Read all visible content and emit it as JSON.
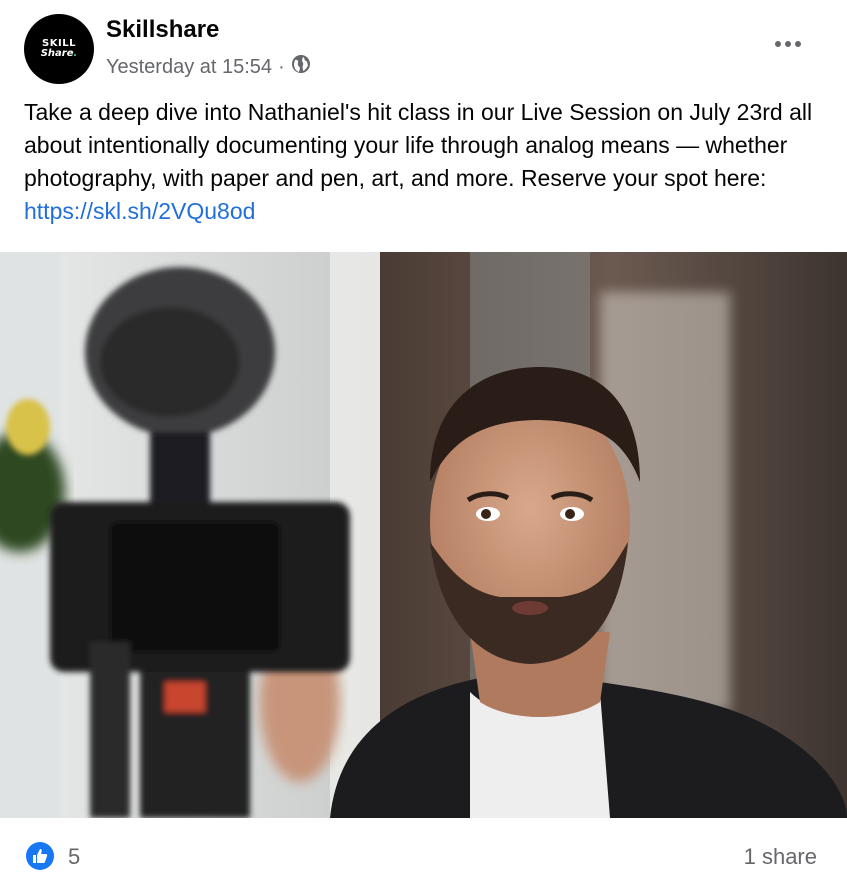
{
  "post": {
    "page_name": "Skillshare",
    "avatar_text": {
      "line1": "SKILL",
      "line2": "Share",
      "dot": "."
    },
    "timestamp": "Yesterday at 15:54",
    "separator": "·",
    "audience_icon": "globe-icon",
    "more_icon": "more-options-icon",
    "text": "Take a deep dive into Nathaniel's hit class in our Live Session on July 23rd all about intentionally documenting your life through analog means — whether photography, with paper and pen, art, and more. Reserve your spot here: ",
    "link": "https://skl.sh/2VQu8od"
  },
  "photo": {
    "icon": "photo"
  },
  "reactions": {
    "icon": "like-icon",
    "count": "5",
    "shares": "1 share"
  },
  "colors": {
    "link": "#216fdb",
    "like_blue": "#1877f2",
    "secondary_text": "#65676b"
  }
}
